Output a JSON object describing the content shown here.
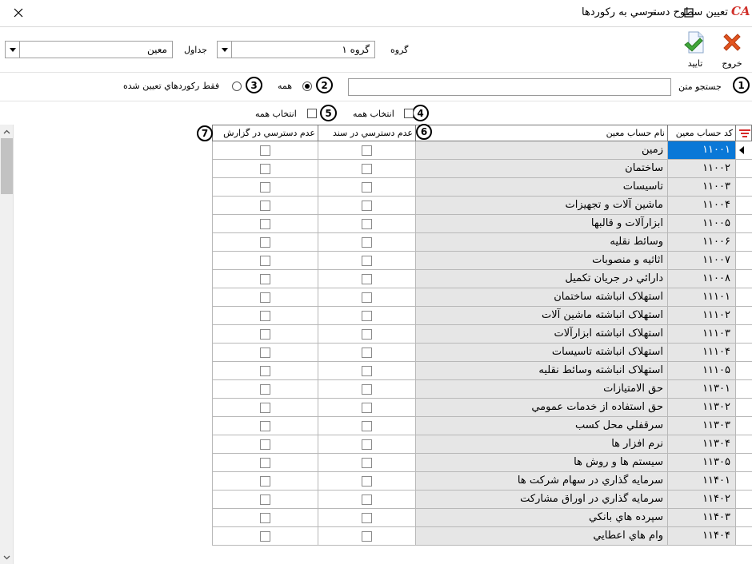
{
  "window": {
    "title": "تعیین سطوح دسترسي به رکوردها",
    "logo_text": "CA"
  },
  "toolbar": {
    "exit_label": "خروج",
    "confirm_label": "تایید",
    "group_label": "گروه",
    "group_value": "گروه ۱",
    "tables_label": "جداول",
    "tables_value": "معین"
  },
  "search": {
    "label": "جستجو متن",
    "value": "",
    "radio_all_label": "همه",
    "radio_assigned_label": "فقط رکوردهاي تعیین شده",
    "selected": "all",
    "right_panel_value": ""
  },
  "select_all": {
    "doc_label": "انتخاب همه",
    "report_label": "انتخاب همه"
  },
  "badges": {
    "b1": "1",
    "b2": "2",
    "b3": "3",
    "b4": "4",
    "b5": "5",
    "b6": "6",
    "b7": "7"
  },
  "grid": {
    "columns": {
      "code": "کد حساب معین",
      "name": "نام حساب معین",
      "no_access_doc": "عدم دسترسي در سند",
      "no_access_report": "عدم دسترسي در گزارش"
    },
    "rows": [
      {
        "code": "۱۱۰۰۱",
        "name": "زمین"
      },
      {
        "code": "۱۱۰۰۲",
        "name": "ساختمان"
      },
      {
        "code": "۱۱۰۰۳",
        "name": "تاسیسات"
      },
      {
        "code": "۱۱۰۰۴",
        "name": "ماشین آلات و تجهیزات"
      },
      {
        "code": "۱۱۰۰۵",
        "name": "ابزارآلات و قالبها"
      },
      {
        "code": "۱۱۰۰۶",
        "name": "وسائط نقلیه"
      },
      {
        "code": "۱۱۰۰۷",
        "name": "اثاثیه و منصوبات"
      },
      {
        "code": "۱۱۰۰۸",
        "name": "دارائي در جریان تکمیل"
      },
      {
        "code": "۱۱۱۰۱",
        "name": "استهلاک انباشته ساختمان"
      },
      {
        "code": "۱۱۱۰۲",
        "name": "استهلاک انباشته ماشین آلات"
      },
      {
        "code": "۱۱۱۰۳",
        "name": "استهلاک انباشته ابزارآلات"
      },
      {
        "code": "۱۱۱۰۴",
        "name": "استهلاک انباشته تاسیسات"
      },
      {
        "code": "۱۱۱۰۵",
        "name": "استهلاک انباشته وسائط نقلیه"
      },
      {
        "code": "۱۱۳۰۱",
        "name": "حق الامتیازات"
      },
      {
        "code": "۱۱۳۰۲",
        "name": "حق استفاده از خدمات عمومي"
      },
      {
        "code": "۱۱۳۰۳",
        "name": "سرقفلي محل کسب"
      },
      {
        "code": "۱۱۳۰۴",
        "name": "نرم افزار ها"
      },
      {
        "code": "۱۱۳۰۵",
        "name": "سیستم  ها و روش ها"
      },
      {
        "code": "۱۱۴۰۱",
        "name": "سرمایه گذاري در سهام شرکت ها"
      },
      {
        "code": "۱۱۴۰۲",
        "name": "سرمایه گذاري در اوراق مشارکت"
      },
      {
        "code": "۱۱۴۰۳",
        "name": "سپرده هاي بانکي"
      },
      {
        "code": "۱۱۴۰۴",
        "name": "وام هاي اعطایي"
      }
    ],
    "selected_row": 0
  },
  "colors": {
    "selection": "#0a78d7",
    "readonly_cell": "#e6e6e6",
    "exit_icon": "#e2541f",
    "confirm_icon": "#3fa63a",
    "filter_icon": "#d82a2a"
  }
}
